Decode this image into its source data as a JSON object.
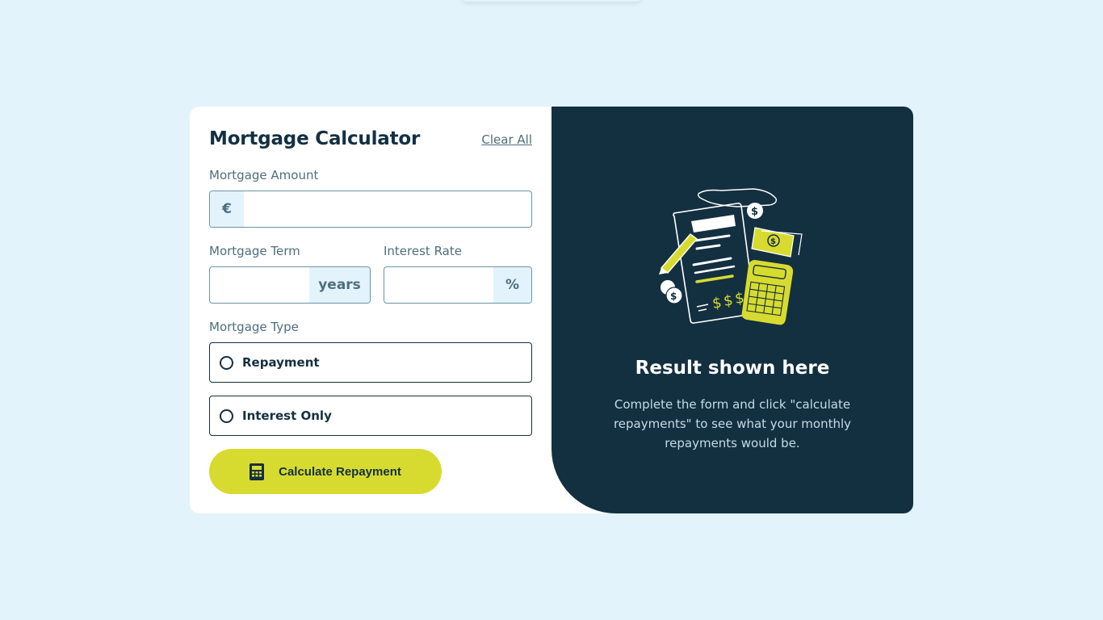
{
  "form": {
    "title": "Mortgage Calculator",
    "clear_label": "Clear All",
    "amount": {
      "label": "Mortgage Amount",
      "prefix": "€",
      "value": "",
      "placeholder": ""
    },
    "term": {
      "label": "Mortgage Term",
      "suffix": "years",
      "value": "",
      "placeholder": ""
    },
    "rate": {
      "label": "Interest Rate",
      "suffix": "%",
      "value": "",
      "placeholder": ""
    },
    "type": {
      "label": "Mortgage Type",
      "options": [
        {
          "label": "Repayment",
          "selected": false
        },
        {
          "label": "Interest Only",
          "selected": false
        }
      ]
    },
    "submit_label": "Calculate Repayment",
    "submit_icon": "calculator-icon"
  },
  "result": {
    "title": "Result shown here",
    "text": "Complete the form and click \"calculate repayments\" to see what your monthly repayments would be.",
    "illustration": "empty-results-illustration"
  },
  "colors": {
    "background": "#e3f3fb",
    "panel": "#133041",
    "accent": "#d8db2f",
    "muted": "#4e6e7e"
  }
}
